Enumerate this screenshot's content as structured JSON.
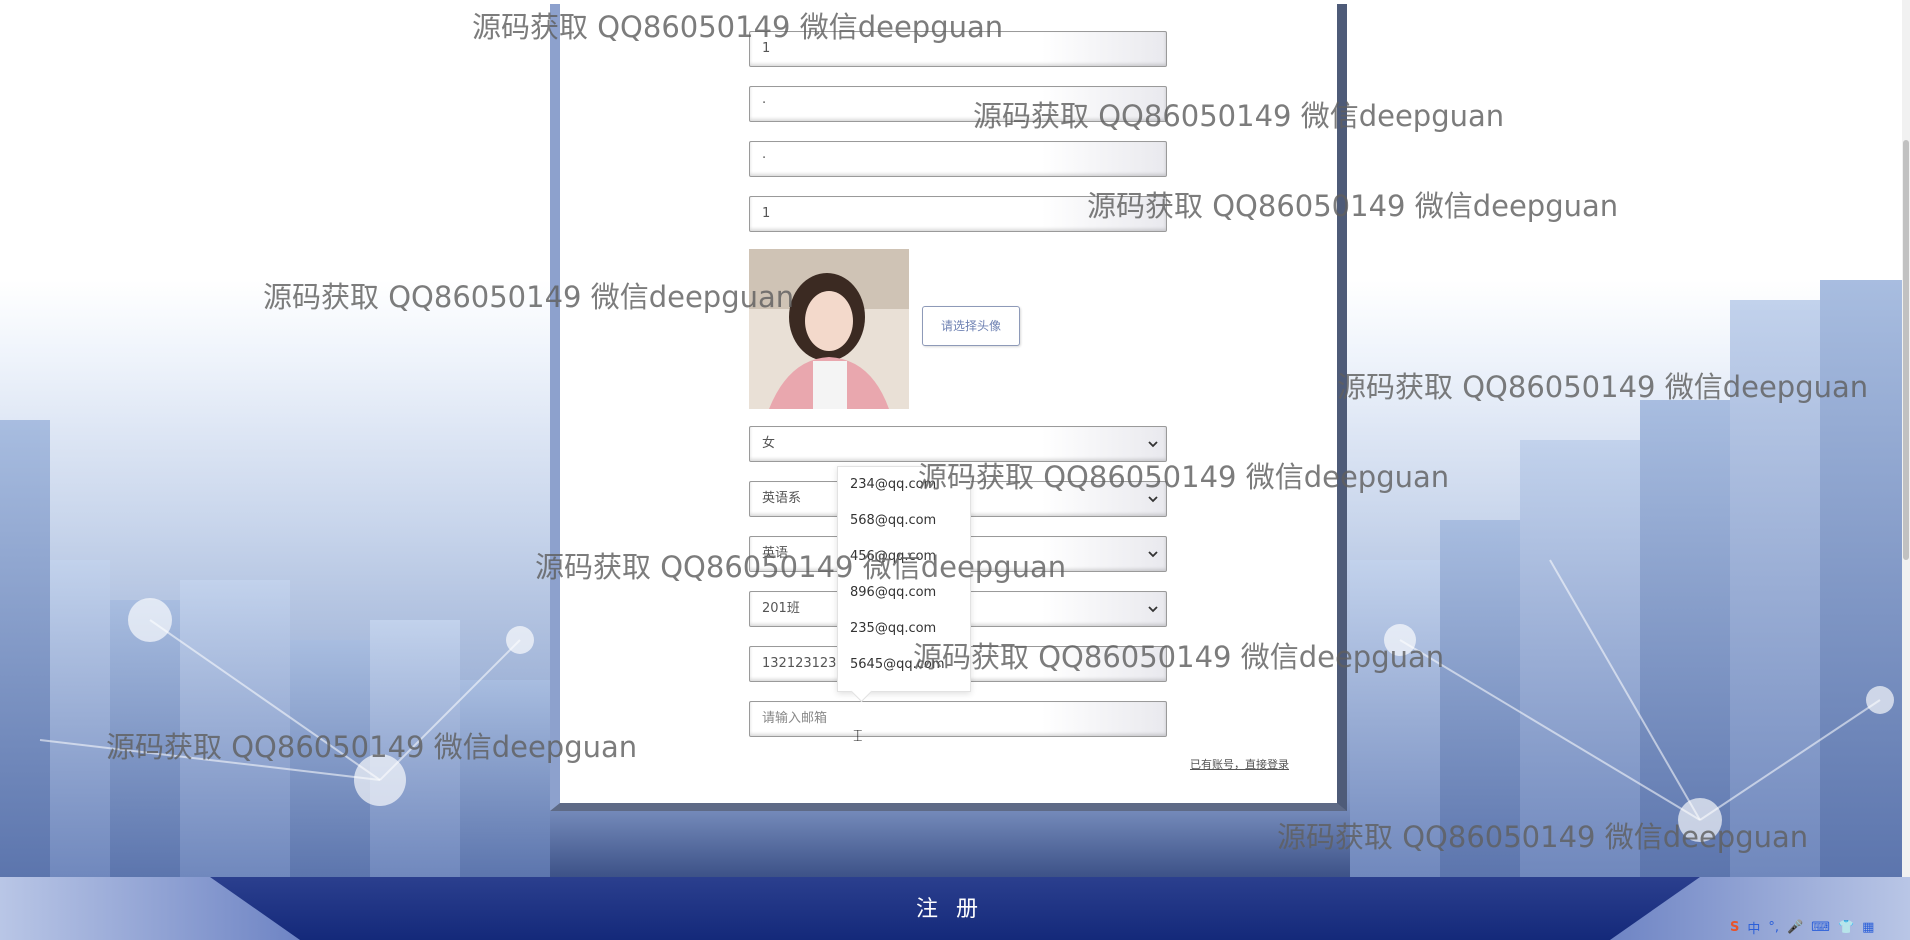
{
  "form": {
    "field1_value": "1",
    "field2_value": "·",
    "field3_value": "·",
    "field4_value": "1",
    "avatar_button_label": "请选择头像",
    "gender_value": "女",
    "department_value": "英语系",
    "major_value": "英语",
    "class_value": "201班",
    "phone_value": "13212312312",
    "email_placeholder": "请输入邮箱",
    "login_link_label": "已有账号，直接登录"
  },
  "email_suggestions": [
    "234@qq.com",
    "568@qq.com",
    "456@qq.com",
    "896@qq.com",
    "235@qq.com",
    "5645@qq.com"
  ],
  "register_button_label": "注 册",
  "watermark_text": "源码获取 QQ86050149 微信deepguan",
  "tray": {
    "ime_label": "中"
  },
  "colors": {
    "panel_border_left": "#8da1cd",
    "panel_border_right": "#4e5b78",
    "bar": "#14297a",
    "avatar_button_text": "#6f82b3"
  },
  "icons": [
    "chevron-down-icon",
    "text-cursor-icon",
    "sogou-ime-icon",
    "microphone-icon",
    "keyboard-icon",
    "shirt-icon",
    "grid-icon"
  ]
}
